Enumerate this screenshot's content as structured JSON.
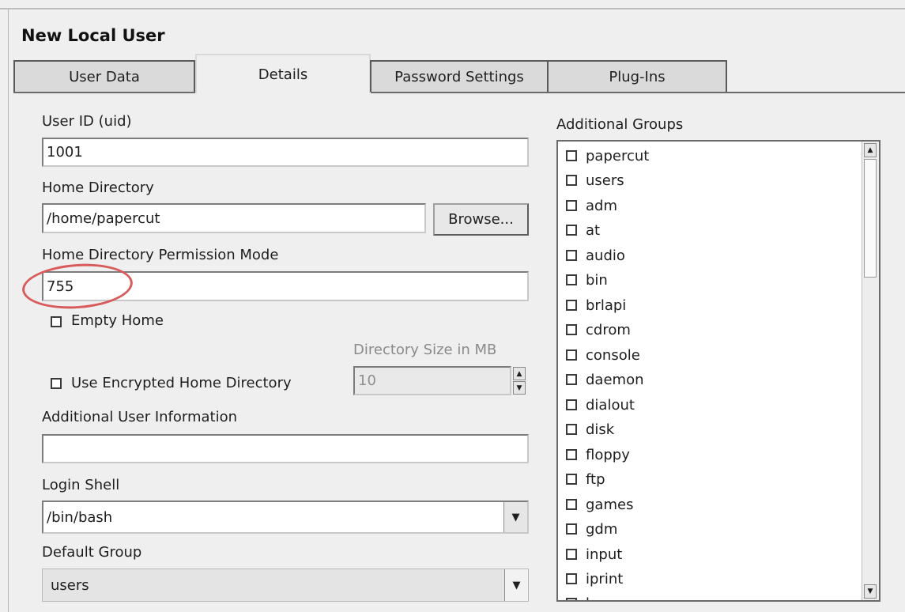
{
  "dialog": {
    "title": "New Local User"
  },
  "tabs": [
    {
      "label": "User Data"
    },
    {
      "label": "Details"
    },
    {
      "label": "Password Settings"
    },
    {
      "label": "Plug-Ins"
    }
  ],
  "details": {
    "user_id": {
      "label": "User ID (uid)",
      "value": "1001"
    },
    "home_directory": {
      "label": "Home Directory",
      "value": "/home/papercut",
      "browse_label": "Browse..."
    },
    "permission_mode": {
      "label": "Home Directory Permission Mode",
      "value": "755"
    },
    "empty_home": {
      "label": "Empty Home",
      "checked": false
    },
    "directory_size": {
      "label": "Directory Size in MB",
      "value": "10",
      "enabled": false
    },
    "encrypted_home": {
      "label": "Use Encrypted Home Directory",
      "checked": false
    },
    "additional_info": {
      "label": "Additional User Information",
      "value": ""
    },
    "login_shell": {
      "label": "Login Shell",
      "value": "/bin/bash"
    },
    "default_group": {
      "label": "Default Group",
      "value": "users"
    }
  },
  "additional_groups": {
    "label": "Additional Groups",
    "items": [
      "papercut",
      "users",
      "adm",
      "at",
      "audio",
      "bin",
      "brlapi",
      "cdrom",
      "console",
      "daemon",
      "dialout",
      "disk",
      "floppy",
      "ftp",
      "games",
      "gdm",
      "input",
      "iprint",
      "kmem"
    ]
  },
  "colors": {
    "highlight_ring": "#d95a5a"
  }
}
